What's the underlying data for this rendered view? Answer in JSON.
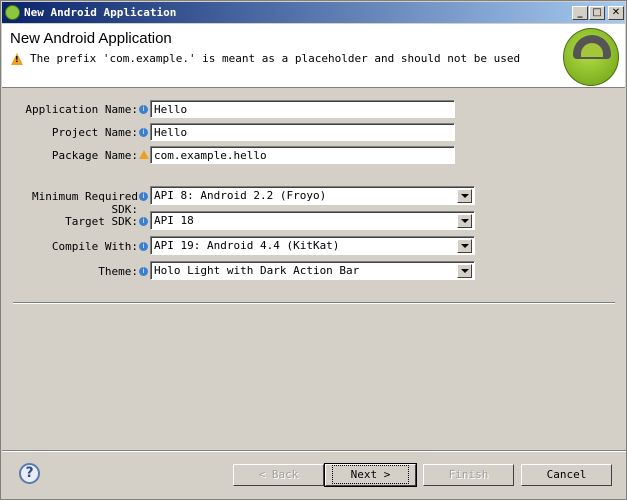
{
  "window": {
    "title": "New Android Application"
  },
  "header": {
    "title": "New Android Application",
    "message": "The prefix 'com.example.' is meant as a placeholder and should not be used"
  },
  "form": {
    "app_name": {
      "label": "Application Name:",
      "value": "Hello"
    },
    "project_name": {
      "label": "Project Name:",
      "value": "Hello"
    },
    "package_name": {
      "label": "Package Name:",
      "value": "com.example.hello"
    },
    "min_sdk": {
      "label": "Minimum Required SDK:",
      "value": "API 8: Android 2.2 (Froyo)"
    },
    "target_sdk": {
      "label": "Target SDK:",
      "value": "API 18"
    },
    "compile_with": {
      "label": "Compile With:",
      "value": "API 19: Android 4.4 (KitKat)"
    },
    "theme": {
      "label": "Theme:",
      "value": "Holo Light with Dark Action Bar"
    }
  },
  "buttons": {
    "back": "< Back",
    "next": "Next >",
    "finish": "Finish",
    "cancel": "Cancel",
    "help": "?"
  }
}
